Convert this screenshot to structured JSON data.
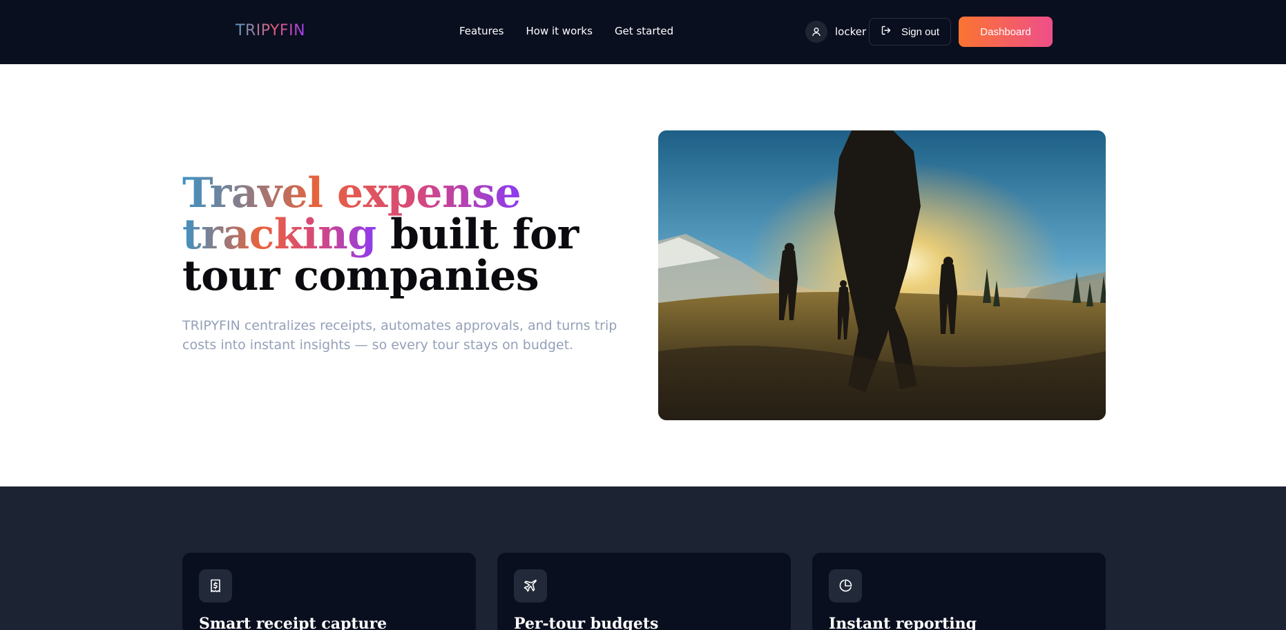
{
  "nav": {
    "logo": "TRIPYFIN",
    "links": [
      "Features",
      "How it works",
      "Get started"
    ],
    "username": "locker",
    "signout_label": "Sign out",
    "dashboard_label": "Dashboard"
  },
  "hero": {
    "title_grad_1": "Travel expense",
    "title_grad_2": "tracking",
    "title_rest_1": " built for",
    "title_rest_2": "tour companies",
    "subtitle": "TRIPYFIN centralizes receipts, automates approvals, and turns trip costs into instant insights — so every tour stays on budget."
  },
  "features": [
    {
      "title": "Smart receipt capture",
      "icon": "receipt-icon"
    },
    {
      "title": "Per-tour budgets",
      "icon": "plane-icon"
    },
    {
      "title": "Instant reporting",
      "icon": "pie-chart-icon"
    }
  ],
  "colors": {
    "nav_bg": "#0a0f1f",
    "accent_orange": "#fb7430",
    "accent_pink": "#ee4f8a",
    "features_bg": "#1c2434"
  }
}
